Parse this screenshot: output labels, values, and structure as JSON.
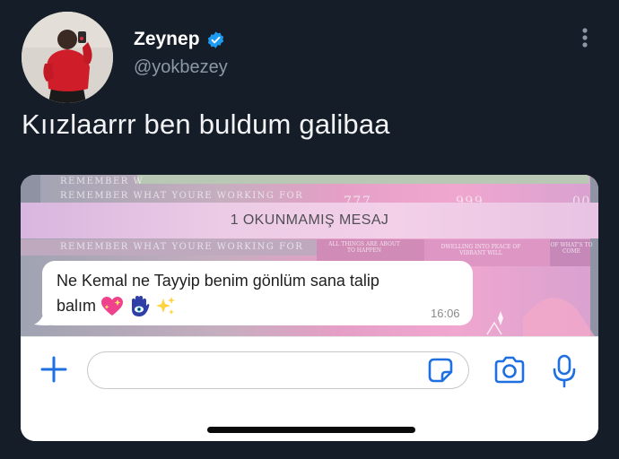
{
  "tweet": {
    "author": {
      "display_name": "Zeynep",
      "handle": "@yokbezey",
      "verified": true,
      "avatar_icon": "profile-photo"
    },
    "text": "Kıızlaarrr ben buldum galibaa",
    "more_icon": "vertical-ellipsis-icon"
  },
  "media": {
    "wallpaper_text": {
      "line1": "REMEMBER W",
      "line2": "REMEMBER WHAT YOURE WORKING FOR",
      "line3": "REMEMBER WHAT YOURE WORKING FOR",
      "numbers_a": "777",
      "numbers_b": "999",
      "numbers_c": "00",
      "small_a": "ALL THINGS ARE ABOUT TO HAPPEN",
      "small_b": "DWELLING INTO PEACE OF VIBRANT WILL",
      "small_c": "OF WHAT'S TO COME"
    },
    "unread_banner": "1 OKUNMAMIŞ MESAJ",
    "message": {
      "line1": "Ne Kemal ne Tayyip benim gönlüm sana talip",
      "line2": "balım",
      "emojis": [
        "sparkling-heart",
        "hamsa",
        "sparkles"
      ],
      "time": "16:06"
    },
    "composer": {
      "plus_icon": "plus-icon",
      "input_value": "",
      "sticker_icon": "sticker-icon",
      "camera_icon": "camera-icon",
      "mic_icon": "microphone-icon"
    },
    "colors": {
      "accent_blue": "#1e6fe0",
      "bubble": "#ffffff",
      "wallpaper_pink": "#e59fc6"
    }
  }
}
